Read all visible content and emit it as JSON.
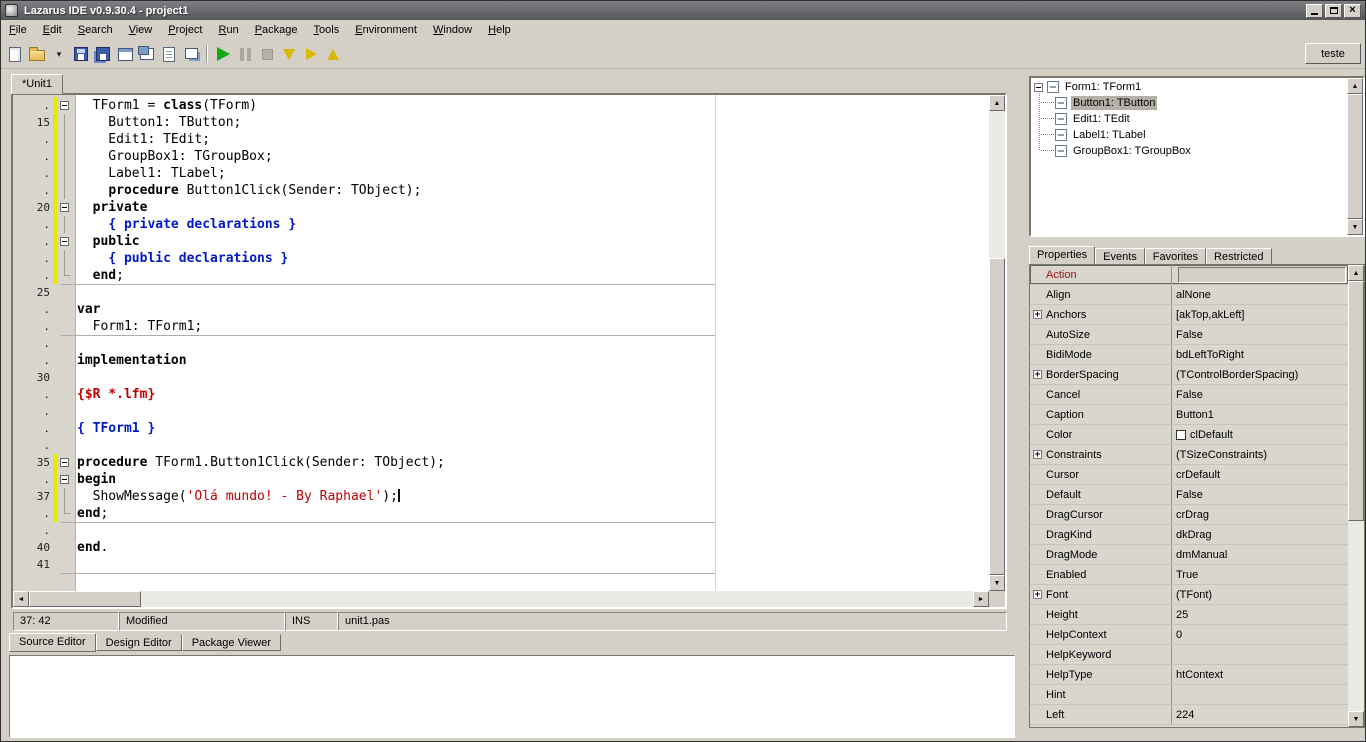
{
  "window": {
    "title": "Lazarus IDE v0.9.30.4 - project1"
  },
  "menu": {
    "items": [
      "File",
      "Edit",
      "Search",
      "View",
      "Project",
      "Run",
      "Package",
      "Tools",
      "Environment",
      "Window",
      "Help"
    ]
  },
  "toolbar": {
    "teste_label": "teste",
    "buttons": [
      {
        "name": "new-unit-icon",
        "icon": "page"
      },
      {
        "name": "open-file-icon",
        "icon": "folder"
      },
      {
        "name": "open-dropdown-icon",
        "icon": "drop"
      },
      {
        "name": "save-icon",
        "icon": "floppy"
      },
      {
        "name": "save-all-icon",
        "icon": "floppy2"
      },
      {
        "name": "new-form-icon",
        "icon": "form"
      },
      {
        "name": "toggle-form-unit-icon",
        "icon": "toggle"
      },
      {
        "name": "view-units-icon",
        "icon": "units"
      },
      {
        "name": "view-forms-icon",
        "icon": "forms"
      },
      {
        "name": "separator",
        "icon": "sep"
      },
      {
        "name": "run-icon",
        "icon": "run"
      },
      {
        "name": "pause-icon",
        "icon": "pause",
        "disabled": true
      },
      {
        "name": "stop-icon",
        "icon": "stop",
        "disabled": true
      },
      {
        "name": "step-into-icon",
        "icon": "stepin"
      },
      {
        "name": "step-over-icon",
        "icon": "stepover"
      },
      {
        "name": "step-out-icon",
        "icon": "stepout"
      }
    ]
  },
  "editor": {
    "tab": "*Unit1",
    "status": {
      "position": "37: 42",
      "state": "Modified",
      "mode": "INS",
      "file": "unit1.pas"
    },
    "lines": [
      {
        "g": ".",
        "fold": "box",
        "mod": true,
        "seg": [
          [
            "  TForm1 = ",
            ""
          ],
          [
            "class",
            "kw"
          ],
          [
            "(TForm)",
            ""
          ]
        ]
      },
      {
        "g": "15",
        "fold": "line",
        "mod": true,
        "seg": [
          [
            "    Button1: TButton;",
            ""
          ]
        ]
      },
      {
        "g": ".",
        "fold": "line",
        "mod": true,
        "seg": [
          [
            "    Edit1: TEdit;",
            ""
          ]
        ]
      },
      {
        "g": ".",
        "fold": "line",
        "mod": true,
        "seg": [
          [
            "    GroupBox1: TGroupBox;",
            ""
          ]
        ]
      },
      {
        "g": ".",
        "fold": "line",
        "mod": true,
        "seg": [
          [
            "    Label1: TLabel;",
            ""
          ]
        ]
      },
      {
        "g": ".",
        "fold": "line",
        "mod": true,
        "seg": [
          [
            "    ",
            ""
          ],
          [
            "procedure",
            "kw"
          ],
          [
            " Button1Click(Sender: TObject);",
            ""
          ]
        ]
      },
      {
        "g": "20",
        "fold": "box",
        "mod": true,
        "seg": [
          [
            "  ",
            ""
          ],
          [
            "private",
            "kw"
          ]
        ]
      },
      {
        "g": ".",
        "fold": "line",
        "mod": true,
        "seg": [
          [
            "    ",
            ""
          ],
          [
            "{ private declarations }",
            "cmt"
          ]
        ]
      },
      {
        "g": ".",
        "fold": "box",
        "mod": true,
        "seg": [
          [
            "  ",
            ""
          ],
          [
            "public",
            "kw"
          ]
        ]
      },
      {
        "g": ".",
        "fold": "line",
        "mod": true,
        "seg": [
          [
            "    ",
            ""
          ],
          [
            "{ public declarations }",
            "cmt"
          ]
        ]
      },
      {
        "g": ".",
        "fold": "end",
        "mod": true,
        "div_below": true,
        "seg": [
          [
            "  ",
            ""
          ],
          [
            "end",
            "kw"
          ],
          [
            ";",
            ""
          ]
        ]
      },
      {
        "g": "25",
        "seg": []
      },
      {
        "g": ".",
        "seg": [
          [
            "var",
            "kw"
          ]
        ]
      },
      {
        "g": ".",
        "div_below": true,
        "seg": [
          [
            "  Form1: TForm1;",
            ""
          ]
        ]
      },
      {
        "g": ".",
        "seg": []
      },
      {
        "g": ".",
        "seg": [
          [
            "implementation",
            "kw"
          ]
        ]
      },
      {
        "g": "30",
        "seg": []
      },
      {
        "g": ".",
        "seg": [
          [
            "{$R *.lfm}",
            "dir"
          ]
        ]
      },
      {
        "g": ".",
        "seg": []
      },
      {
        "g": ".",
        "seg": [
          [
            "{ TForm1 }",
            "cmt"
          ]
        ]
      },
      {
        "g": ".",
        "seg": []
      },
      {
        "g": "35",
        "fold": "box",
        "mod": true,
        "seg": [
          [
            "procedure",
            "kw"
          ],
          [
            " TForm1.Button1Click(Sender: TObject);",
            ""
          ]
        ]
      },
      {
        "g": ".",
        "fold": "box",
        "mod": true,
        "seg": [
          [
            "begin",
            "kw"
          ]
        ]
      },
      {
        "g": "37",
        "fold": "line",
        "mod": true,
        "caret": true,
        "seg": [
          [
            "  ShowMessage(",
            ""
          ],
          [
            "'Olá mundo! - By Raphael'",
            "str"
          ],
          [
            ");",
            ""
          ]
        ]
      },
      {
        "g": ".",
        "fold": "end",
        "mod": true,
        "div_below": true,
        "seg": [
          [
            "end",
            "kw"
          ],
          [
            ";",
            ""
          ]
        ]
      },
      {
        "g": ".",
        "seg": []
      },
      {
        "g": "40",
        "seg": [
          [
            "end",
            "kw"
          ],
          [
            ".",
            ""
          ]
        ]
      },
      {
        "g": "41",
        "div_below": true,
        "seg": []
      }
    ]
  },
  "bottom_tabs": [
    "Source Editor",
    "Design Editor",
    "Package Viewer"
  ],
  "inspector": {
    "tree": [
      {
        "label": "Form1: TForm1",
        "root": true
      },
      {
        "label": "Button1: TButton",
        "selected": true
      },
      {
        "label": "Edit1: TEdit"
      },
      {
        "label": "Label1: TLabel"
      },
      {
        "label": "GroupBox1: TGroupBox"
      }
    ],
    "tabs": [
      "Properties",
      "Events",
      "Favorites",
      "Restricted"
    ],
    "properties": [
      {
        "name": "Action",
        "value": "",
        "selected": true
      },
      {
        "name": "Align",
        "value": "alNone"
      },
      {
        "name": "Anchors",
        "value": "[akTop,akLeft]",
        "expand": true
      },
      {
        "name": "AutoSize",
        "value": "False"
      },
      {
        "name": "BidiMode",
        "value": "bdLeftToRight"
      },
      {
        "name": "BorderSpacing",
        "value": "(TControlBorderSpacing)",
        "expand": true
      },
      {
        "name": "Cancel",
        "value": "False"
      },
      {
        "name": "Caption",
        "value": "Button1"
      },
      {
        "name": "Color",
        "value": "clDefault",
        "swatch": true
      },
      {
        "name": "Constraints",
        "value": "(TSizeConstraints)",
        "expand": true
      },
      {
        "name": "Cursor",
        "value": "crDefault"
      },
      {
        "name": "Default",
        "value": "False"
      },
      {
        "name": "DragCursor",
        "value": "crDrag"
      },
      {
        "name": "DragKind",
        "value": "dkDrag"
      },
      {
        "name": "DragMode",
        "value": "dmManual"
      },
      {
        "name": "Enabled",
        "value": "True"
      },
      {
        "name": "Font",
        "value": "(TFont)",
        "expand": true
      },
      {
        "name": "Height",
        "value": "25"
      },
      {
        "name": "HelpContext",
        "value": "0"
      },
      {
        "name": "HelpKeyword",
        "value": ""
      },
      {
        "name": "HelpType",
        "value": "htContext"
      },
      {
        "name": "Hint",
        "value": ""
      },
      {
        "name": "Left",
        "value": "224"
      }
    ]
  },
  "colors": {
    "titlebar": "#55575a",
    "window_bg": "#d4d0c8",
    "keyword": "#000000",
    "comment": "#0018c8",
    "string": "#c00000",
    "directive": "#c00000",
    "run_green": "#13a913",
    "modified_bar": "#e8e800",
    "selected_property": "#9e1414"
  }
}
